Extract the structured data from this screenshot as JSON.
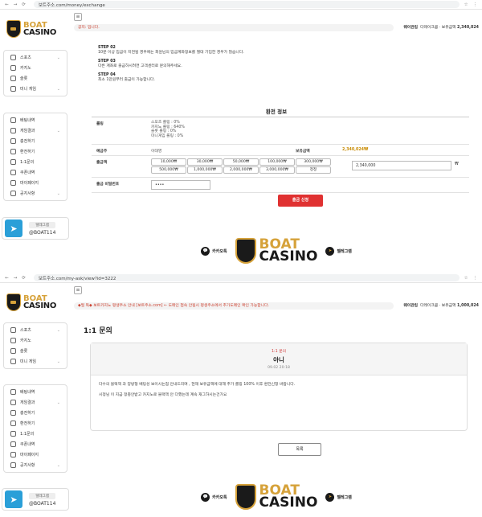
{
  "brand": {
    "line1": "BOAT",
    "line2": "CASINO"
  },
  "shot1": {
    "url": "보트주소.com/money/exchange",
    "notice": "공지: 입니다.",
    "user": {
      "name_label": "웨이관립",
      "level": "다레이크쿰",
      "balance_label": "보유금액",
      "balance": "2,340,024"
    },
    "steps": [
      {
        "title": "STEP 02",
        "text": "10분 이상 입금이 지연될 경우에는 회원님의 입금계좌정보를 절대 기입한 경우가 많습니다."
      },
      {
        "title": "STEP 03",
        "text": "다른 계좌로 출금하시려면 고객센터로 문의해주세요."
      },
      {
        "title": "STEP 04",
        "text": "최소 1만원부터 출금이 가능합니다."
      }
    ],
    "section_title": "환전 정보",
    "rows": {
      "rolling_label": "롤링",
      "rolling_lines": [
        "스포츠 롤링 : 0%",
        "카지노 롤링 : 640%",
        "슬롯 롤링 : 0%",
        "미니게임 롤링 : 0%"
      ],
      "holder_label": "예금주",
      "holder_value": "이태영",
      "balance_label": "보유금액",
      "balance_value": "2,340,024₩",
      "amount_label": "출금액",
      "amount_buttons_row1": [
        "10,000₩",
        "30,000₩",
        "50,000₩",
        "100,000₩",
        "300,000₩"
      ],
      "amount_buttons_row2": [
        "500,000₩",
        "1,000,000₩",
        "2,000,000₩",
        "3,000,000₩",
        "정정"
      ],
      "amount_input": "2,340,000",
      "amount_unit": "₩",
      "password_label": "출금 비밀번호",
      "password_value": "••••"
    },
    "submit": "출금 신청"
  },
  "shot2": {
    "url": "보트주소.com/my-ask/view?id=3222",
    "notice": "◆필 독◆ 보트카지노 평생주소 안내 [보트주소.com] ← 도메인 접속 안될시 평생주소에서 추가도메인 확인 가능합니다.",
    "user": {
      "name_label": "웨이관립",
      "level": "다레이크쿰",
      "balance_label": "보유금액",
      "balance": "1,000,024"
    },
    "page_title": "1:1 문의",
    "category": "1:1 문의",
    "subject": "아니",
    "date": "09.02 20:18",
    "answer_lines": [
      "다수의 블랙잭 과 양방형 베팅성 보이시는점 안내드리며 , 현재 보유금액에 대해 추가 롤링 100% 이후 환전신청 바랍니다.",
      "시정님 이 지금 정충안받고 카지노로 블랙잭 안 다했는데 계속 재그하시는건가요"
    ],
    "list_button": "목록"
  },
  "sidebar": {
    "group1": [
      "스포츠",
      "카지노",
      "슬롯",
      "미니 게임"
    ],
    "group2": [
      "배팅내역",
      "게임결과",
      "충전하기",
      "환전하기",
      "1:1문의",
      "쿠폰내역",
      "마이페이지",
      "공지사항"
    ],
    "telegram_label": "텔레그램",
    "telegram_handle": "@BOAT114"
  },
  "footer": {
    "kakao": "카카오톡",
    "telegram": "텔레그램"
  }
}
